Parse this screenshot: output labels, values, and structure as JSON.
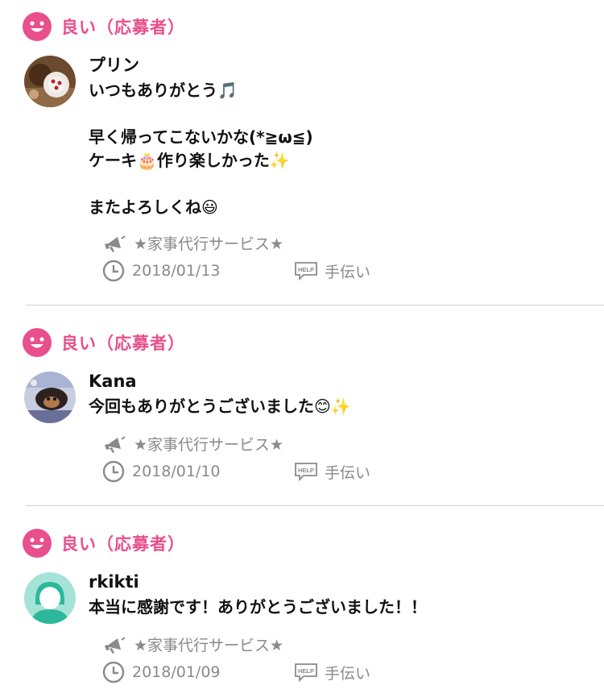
{
  "colors": {
    "rating_pink": "#e84f8c",
    "meta_gray": "#8a8a8a",
    "divider": "#d0d0d0",
    "default_avatar_bg": "#a5e3d6",
    "default_avatar_fg": "#2bb89b"
  },
  "reviews": [
    {
      "rating_icon": "smile-icon",
      "rating_label": "良い（応募者）",
      "user": "プリン",
      "message": "いつもありがとう🎵\n\n早く帰ってこないかな(*≧ω≦)\nケーキ🎂作り楽しかった✨\n\nまたよろしくね😃",
      "category_icon": "megaphone-icon",
      "category": "★家事代行サービス★",
      "date": "2018/01/13",
      "tag_icon": "help-icon",
      "tag": "手伝い"
    },
    {
      "rating_icon": "smile-icon",
      "rating_label": "良い（応募者）",
      "user": "Kana",
      "message": "今回もありがとうございました😊✨",
      "category_icon": "megaphone-icon",
      "category": "★家事代行サービス★",
      "date": "2018/01/10",
      "tag_icon": "help-icon",
      "tag": "手伝い"
    },
    {
      "rating_icon": "smile-icon",
      "rating_label": "良い（応募者）",
      "user": "rkikti",
      "message": "本当に感謝です！ありがとうございました！！",
      "category_icon": "megaphone-icon",
      "category": "★家事代行サービス★",
      "date": "2018/01/09",
      "tag_icon": "help-icon",
      "tag": "手伝い"
    }
  ]
}
